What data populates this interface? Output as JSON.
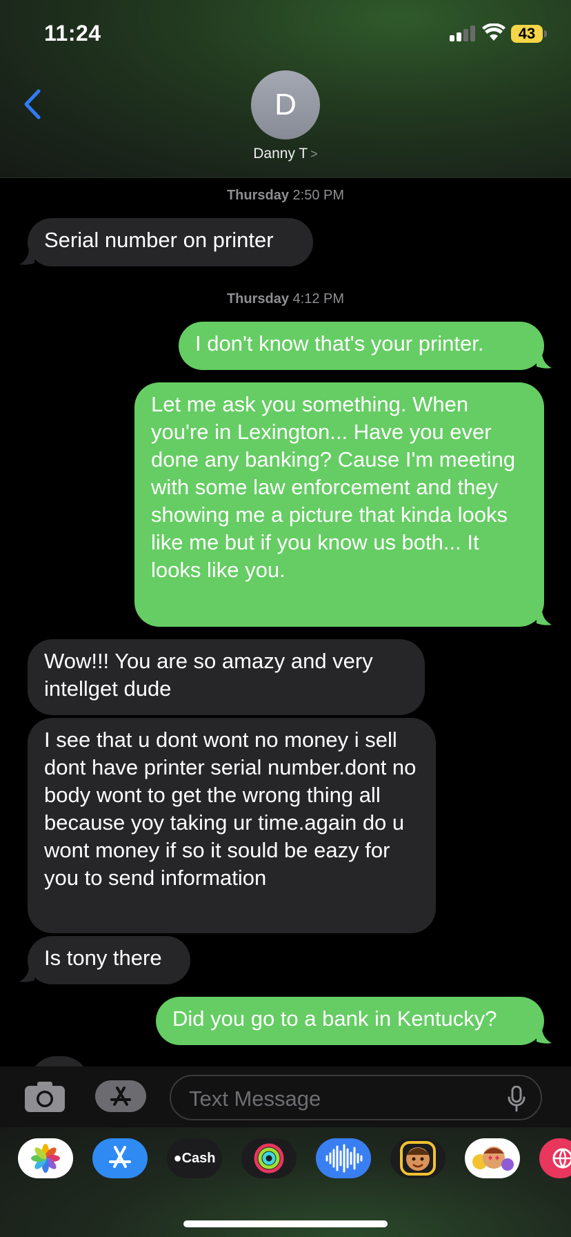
{
  "status_bar": {
    "time": "11:24",
    "battery": "43"
  },
  "header": {
    "avatar_initial": "D",
    "contact_name": "Danny T",
    "contact_chevron": ">"
  },
  "messages": [
    {
      "type": "timestamp",
      "day": "Thursday",
      "time": "2:50 PM"
    },
    {
      "type": "incoming",
      "text": "Serial number on printer"
    },
    {
      "type": "timestamp",
      "day": "Thursday",
      "time": "4:12 PM"
    },
    {
      "type": "outgoing",
      "text": "I don't know that's your printer."
    },
    {
      "type": "outgoing",
      "text": "Let me ask you something. When you're in Lexington... Have you ever done any banking? Cause I'm meeting with some law enforcement and they showing me a picture that kinda looks like me but if you know us both... It looks like you."
    },
    {
      "type": "incoming",
      "text": "Wow!!! You are so amazy and very intellget dude"
    },
    {
      "type": "incoming",
      "text": "I see that u dont wont no money i sell dont have printer serial number.dont no  body wont to get the wrong thing all because yoy taking ur time.again do u wont money if so it sould be eazy for you to send information"
    },
    {
      "type": "incoming",
      "text": "Is tony there"
    },
    {
      "type": "outgoing",
      "text": "Did you go to a bank in Kentucky?"
    }
  ],
  "input": {
    "placeholder": "Text Message"
  },
  "app_drawer": {
    "cash_label": "Cash",
    "apps": [
      "photos-app",
      "app-store-app",
      "apple-cash-app",
      "activity-app",
      "voice-memo-app",
      "memoji-app",
      "animoji-app",
      "web-app"
    ]
  },
  "colors": {
    "outgoing": "#65cd63",
    "incoming": "#262629",
    "accent": "#2f7cf6",
    "battery": "#f5d547"
  }
}
